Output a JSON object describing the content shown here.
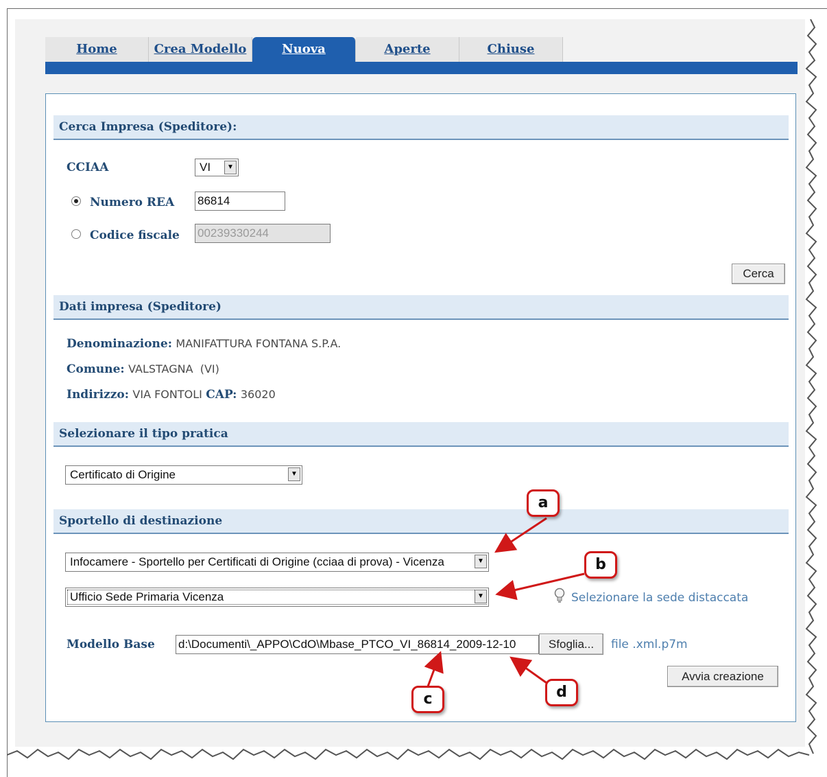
{
  "tabs": [
    {
      "label": "Home",
      "active": false
    },
    {
      "label": "Crea Modello",
      "active": false
    },
    {
      "label": "Nuova",
      "active": true
    },
    {
      "label": "Aperte",
      "active": false
    },
    {
      "label": "Chiuse",
      "active": false
    }
  ],
  "search": {
    "title": "Cerca Impresa (Speditore):",
    "cciaa_label": "CCIAA",
    "cciaa_value": "VI",
    "rea_label": "Numero REA",
    "rea_value": "86814",
    "cf_label": "Codice fiscale",
    "cf_value": "00239330244",
    "search_button": "Cerca"
  },
  "company": {
    "title": "Dati impresa (Speditore)",
    "name_label": "Denominazione:",
    "name_value": "MANIFATTURA FONTANA S.P.A.",
    "comune_label": "Comune:",
    "comune_value": "VALSTAGNA  (VI)",
    "address_label": "Indirizzo:",
    "address_value": "VIA FONTOLI",
    "cap_label": "CAP:",
    "cap_value": "36020"
  },
  "practice": {
    "title": "Selezionare il tipo pratica",
    "selected": "Certificato di Origine"
  },
  "destination": {
    "title": "Sportello di destinazione",
    "office_selected": "Infocamere - Sportello per Certificati di Origine (cciaa di prova) - Vicenza",
    "branch_selected": "Ufficio Sede Primaria Vicenza",
    "branch_hint": "Selezionare la sede distaccata"
  },
  "model": {
    "label": "Modello Base",
    "file_value": "d:\\Documenti\\_APPO\\CdO\\Mbase_PTCO_VI_86814_2009-12-10",
    "browse_button": "Sfoglia...",
    "file_hint": "file .xml.p7m",
    "create_button": "Avvia creazione"
  },
  "callouts": [
    "a",
    "b",
    "c",
    "d"
  ],
  "colors": {
    "accent": "#1f5fae",
    "header_text": "#234b74",
    "callout_border": "#d01818",
    "hint": "#4e7fae"
  }
}
